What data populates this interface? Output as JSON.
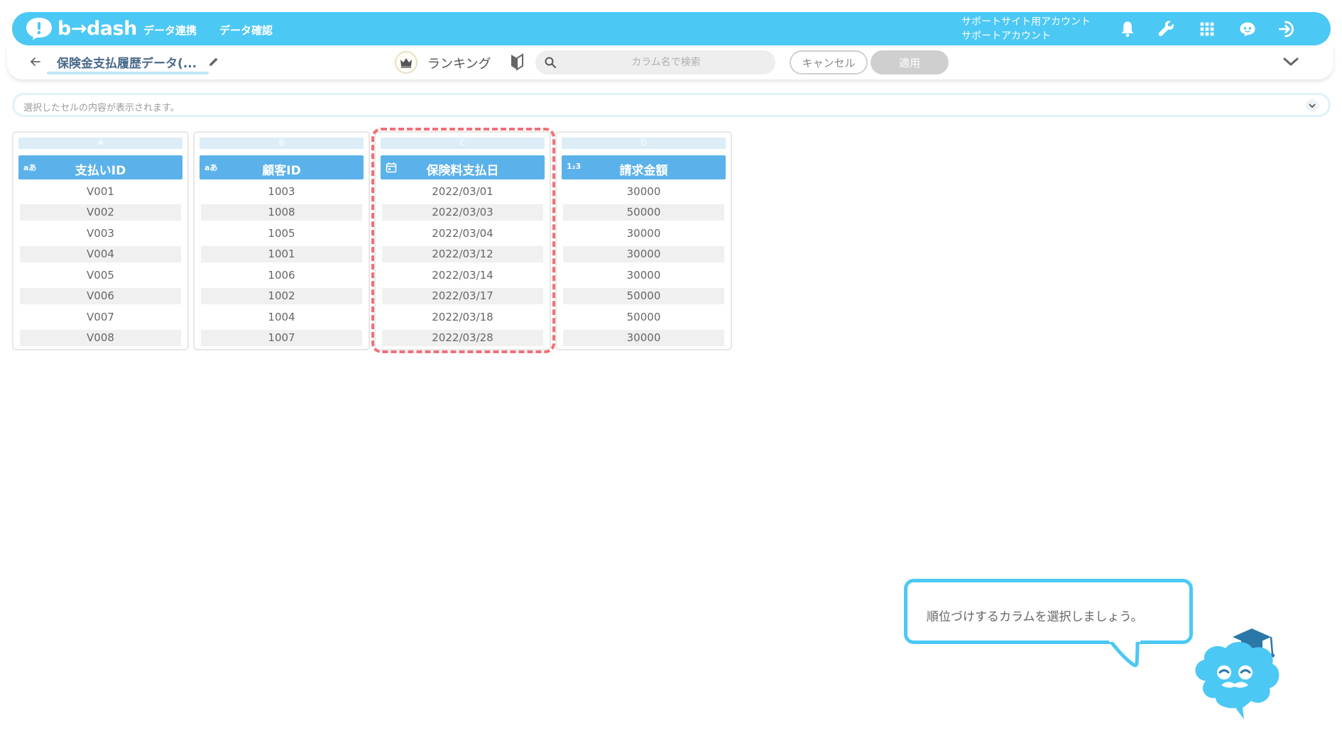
{
  "topbar": {
    "brand": "b→dash",
    "nav": [
      "データ連携",
      "データ確認"
    ],
    "account_line1": "サポートサイト用アカウント",
    "account_line2": "サポートアカウント",
    "icons": [
      "bell-icon",
      "wrench-icon",
      "apps-grid-icon",
      "chat-mascot-icon",
      "logout-icon"
    ],
    "color": "#4cc8f4"
  },
  "toolbar": {
    "dataset_name": "保険金支払履歴データ(...",
    "mode_label": "ランキング",
    "search_placeholder": "カラム名で検索",
    "cancel_label": "キャンセル",
    "apply_label": "適用"
  },
  "cellbar": {
    "placeholder": "選択したセルの内容が表示されます。"
  },
  "columns": [
    {
      "letter": "A",
      "type": "aあ",
      "title": "支払いID",
      "rows": [
        "V001",
        "V002",
        "V003",
        "V004",
        "V005",
        "V006",
        "V007",
        "V008"
      ]
    },
    {
      "letter": "B",
      "type": "aあ",
      "title": "顧客ID",
      "rows": [
        "1003",
        "1008",
        "1005",
        "1001",
        "1006",
        "1002",
        "1004",
        "1007"
      ]
    },
    {
      "letter": "C",
      "type": "calendar",
      "title": "保険料支払日",
      "rows": [
        "2022/03/01",
        "2022/03/03",
        "2022/03/04",
        "2022/03/12",
        "2022/03/14",
        "2022/03/17",
        "2022/03/18",
        "2022/03/28"
      ]
    },
    {
      "letter": "D",
      "type": "1₂3",
      "title": "請求金額",
      "rows": [
        "30000",
        "50000",
        "30000",
        "30000",
        "30000",
        "50000",
        "50000",
        "30000"
      ]
    }
  ],
  "highlight_color": "#f07078",
  "tutorial": {
    "message": "順位づけするカラムを選択しましょう。"
  }
}
